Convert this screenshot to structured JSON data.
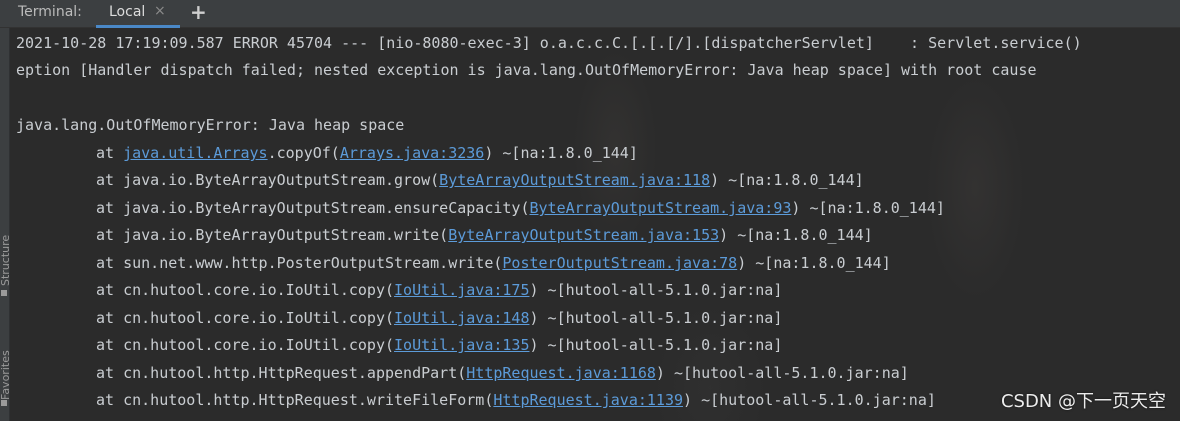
{
  "toolbar": {
    "title": "Terminal:",
    "tab_label": "Local",
    "tab_close": "×",
    "add_label": "+"
  },
  "side_strip": {
    "structure_label": "Structure",
    "favorites_label": "Favorites"
  },
  "log": {
    "line1": "2021-10-28 17:19:09.587 ERROR 45704 --- [nio-8080-exec-3] o.a.c.c.C.[.[.[/].[dispatcherServlet]    : Servlet.service()",
    "line2": "eption [Handler dispatch failed; nested exception is java.lang.OutOfMemoryError: Java heap space] with root cause",
    "line3": "java.lang.OutOfMemoryError: Java heap space",
    "frames": [
      {
        "prefix": "at ",
        "method_link": "java.util.Arrays",
        "method_rest": ".copyOf(",
        "source": "Arrays.java:3236",
        "suffix": ") ~[na:1.8.0_144]"
      },
      {
        "prefix": "at java.io.ByteArrayOutputStream.grow(",
        "source": "ByteArrayOutputStream.java:118",
        "suffix": ") ~[na:1.8.0_144]"
      },
      {
        "prefix": "at java.io.ByteArrayOutputStream.ensureCapacity(",
        "source": "ByteArrayOutputStream.java:93",
        "suffix": ") ~[na:1.8.0_144]"
      },
      {
        "prefix": "at java.io.ByteArrayOutputStream.write(",
        "source": "ByteArrayOutputStream.java:153",
        "suffix": ") ~[na:1.8.0_144]"
      },
      {
        "prefix": "at sun.net.www.http.PosterOutputStream.write(",
        "source": "PosterOutputStream.java:78",
        "suffix": ") ~[na:1.8.0_144]"
      },
      {
        "prefix": "at cn.hutool.core.io.IoUtil.copy(",
        "source": "IoUtil.java:175",
        "suffix": ") ~[hutool-all-5.1.0.jar:na]"
      },
      {
        "prefix": "at cn.hutool.core.io.IoUtil.copy(",
        "source": "IoUtil.java:148",
        "suffix": ") ~[hutool-all-5.1.0.jar:na]"
      },
      {
        "prefix": "at cn.hutool.core.io.IoUtil.copy(",
        "source": "IoUtil.java:135",
        "suffix": ") ~[hutool-all-5.1.0.jar:na]"
      },
      {
        "prefix": "at cn.hutool.http.HttpRequest.appendPart(",
        "source": "HttpRequest.java:1168",
        "suffix": ") ~[hutool-all-5.1.0.jar:na]"
      },
      {
        "prefix": "at cn.hutool.http.HttpRequest.writeFileForm(",
        "source": "HttpRequest.java:1139",
        "suffix": ") ~[hutool-all-5.1.0.jar:na]"
      }
    ]
  },
  "watermark": "CSDN @下一页天空",
  "colors": {
    "background": "#2b2b2b",
    "text": "#c9cdd1",
    "link": "#5c9bd9",
    "tab_accent": "#4a88c7"
  }
}
